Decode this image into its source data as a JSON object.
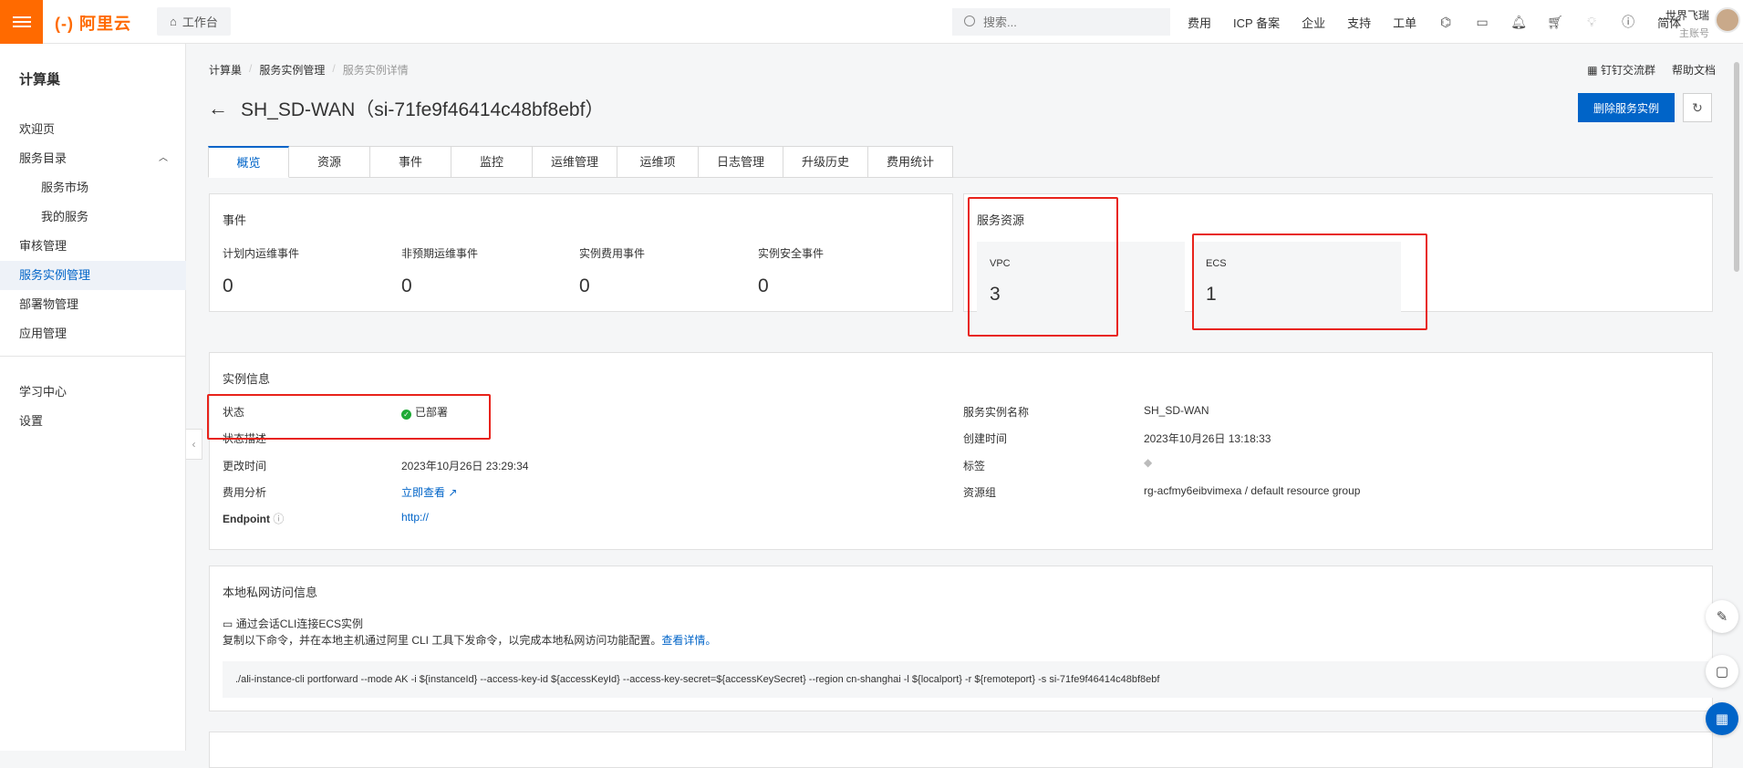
{
  "header": {
    "logo": "(-) 阿里云",
    "workbench": "工作台",
    "search_placeholder": "搜索...",
    "links": [
      "费用",
      "ICP 备案",
      "企业",
      "支持",
      "工单"
    ],
    "lang": "简体",
    "user_name": "世界飞瑞",
    "user_role": "主账号"
  },
  "sidebar": {
    "title": "计算巢",
    "items": [
      {
        "label": "欢迎页"
      },
      {
        "label": "服务目录"
      },
      {
        "label": "服务市场"
      },
      {
        "label": "我的服务"
      },
      {
        "label": "审核管理"
      },
      {
        "label": "服务实例管理"
      },
      {
        "label": "部署物管理"
      },
      {
        "label": "应用管理"
      },
      {
        "label": "学习中心"
      },
      {
        "label": "设置"
      }
    ]
  },
  "breadcrumb": [
    "计算巢",
    "服务实例管理",
    "服务实例详情"
  ],
  "top_right_links": [
    "钉钉交流群",
    "帮助文档"
  ],
  "page_title": "SH_SD-WAN（si-71fe9f46414c48bf8ebf）",
  "delete_button": "删除服务实例",
  "tabs": [
    "概览",
    "资源",
    "事件",
    "监控",
    "运维管理",
    "运维项",
    "日志管理",
    "升级历史",
    "费用统计"
  ],
  "events": {
    "title": "事件",
    "items": [
      {
        "label": "计划内运维事件",
        "value": "0"
      },
      {
        "label": "非预期运维事件",
        "value": "0"
      },
      {
        "label": "实例费用事件",
        "value": "0"
      },
      {
        "label": "实例安全事件",
        "value": "0"
      }
    ]
  },
  "resources": {
    "title": "服务资源",
    "vpc_label": "VPC",
    "vpc_value": "3",
    "ecs_label": "ECS",
    "ecs_value": "1"
  },
  "instance_info": {
    "title": "实例信息",
    "left": [
      {
        "label": "状态",
        "value": "已部署"
      },
      {
        "label": "状态描述",
        "value": ""
      },
      {
        "label": "更改时间",
        "value": "2023年10月26日 23:29:34"
      },
      {
        "label": "费用分析",
        "value": "立即查看"
      },
      {
        "label": "Endpoint",
        "value": "http://"
      }
    ],
    "right": [
      {
        "label": "服务实例名称",
        "value": "SH_SD-WAN"
      },
      {
        "label": "创建时间",
        "value": "2023年10月26日 13:18:33"
      },
      {
        "label": "标签",
        "value": ""
      },
      {
        "label": "资源组",
        "value": "rg-acfmy6eibvimexa / default resource group"
      }
    ]
  },
  "private_access": {
    "title": "本地私网访问信息",
    "subtitle": "通过会话CLI连接ECS实例",
    "desc": "复制以下命令，并在本地主机通过阿里 CLI 工具下发命令，以完成本地私网访问功能配置。",
    "desc_link": "查看详情。",
    "command": "./ali-instance-cli portforward --mode AK -i ${instanceId} --access-key-id ${accessKeyId} --access-key-secret=${accessKeySecret} --region cn-shanghai -l ${localport} -r ${remoteport} -s si-71fe9f46414c48bf8ebf"
  },
  "colors": {
    "accent": "#0064c8",
    "brand": "#ff6a00",
    "highlight": "#e8231b",
    "success": "#1faa36"
  }
}
